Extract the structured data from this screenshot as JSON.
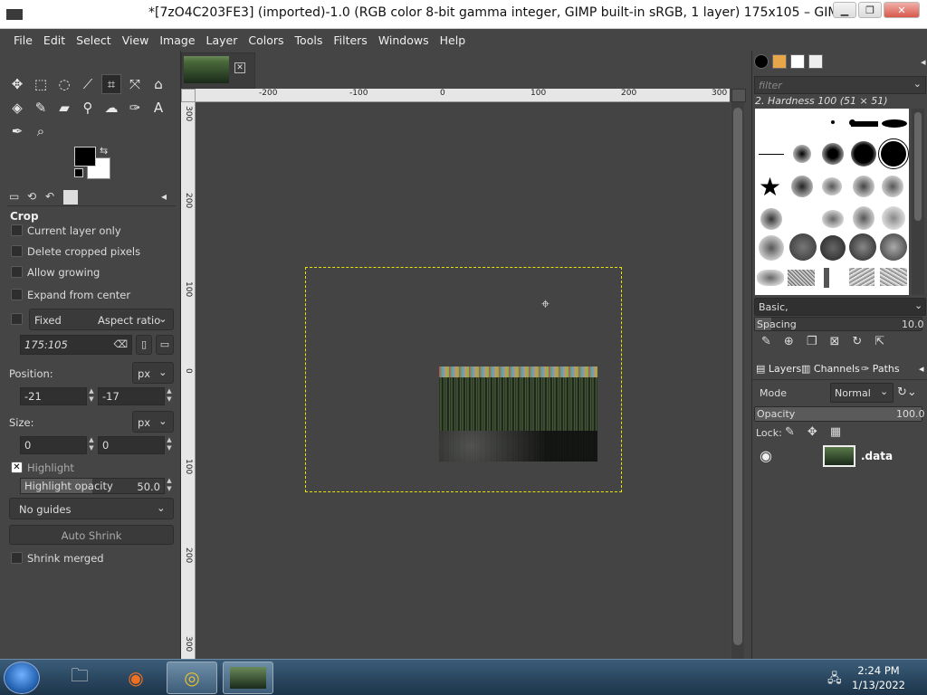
{
  "window": {
    "title": "*[7zO4C203FE3] (imported)-1.0 (RGB color 8-bit gamma integer, GIMP built-in sRGB, 1 layer) 175x105 – GIMP",
    "buttons": [
      "minimize",
      "restore",
      "close"
    ]
  },
  "menu": [
    "File",
    "Edit",
    "Select",
    "View",
    "Image",
    "Layer",
    "Colors",
    "Tools",
    "Filters",
    "Windows",
    "Help"
  ],
  "toolbox": {
    "tools": [
      "move-icon",
      "rect-select-icon",
      "lasso-icon",
      "fuzzy-select-icon",
      "crop-icon",
      "transform-icon",
      "warp-icon",
      "bucket-fill-icon",
      "paintbrush-icon",
      "eraser-icon",
      "clone-icon",
      "smudge-icon",
      "paths-icon",
      "text-icon",
      "color-picker-icon",
      "zoom-icon"
    ],
    "tabs": [
      "tool-options-icon",
      "device-status-icon",
      "undo-history-icon",
      "images-icon"
    ]
  },
  "crop_options": {
    "title": "Crop",
    "current_layer_only": "Current layer only",
    "delete_cropped": "Delete cropped pixels",
    "allow_growing": "Allow growing",
    "expand_from_center": "Expand from center",
    "fixed_label": "Fixed",
    "fixed_mode": "Aspect ratio",
    "ratio_value": "175:105",
    "position_label": "Position:",
    "position_unit": "px",
    "pos_x": "-21",
    "pos_y": "-17",
    "size_label": "Size:",
    "size_unit": "px",
    "size_w": "0",
    "size_h": "0",
    "highlight_label": "Highlight",
    "highlight_opacity_label": "Highlight opacity",
    "highlight_opacity_value": "50.0",
    "guides": "No guides",
    "auto_shrink": "Auto Shrink",
    "shrink_merged": "Shrink merged"
  },
  "rulers": {
    "h_ticks": [
      "-200",
      "-100",
      "0",
      "100",
      "200",
      "300"
    ],
    "v_ticks": [
      "300",
      "200",
      "100",
      "0",
      "100",
      "200",
      "300"
    ]
  },
  "brushes": {
    "filter_placeholder": "filter",
    "selected": "2. Hardness 100 (51 × 51)",
    "tag": "Basic,",
    "spacing_label": "Spacing",
    "spacing_value": "10.0"
  },
  "layers": {
    "tabs": [
      "Layers",
      "Channels",
      "Paths"
    ],
    "mode_label": "Mode",
    "mode_value": "Normal",
    "opacity_label": "Opacity",
    "opacity_value": "100.0",
    "lock_label": "Lock:",
    "items": [
      {
        "name": ".data"
      }
    ]
  },
  "taskbar": {
    "time": "2:24 PM",
    "date": "1/13/2022"
  }
}
